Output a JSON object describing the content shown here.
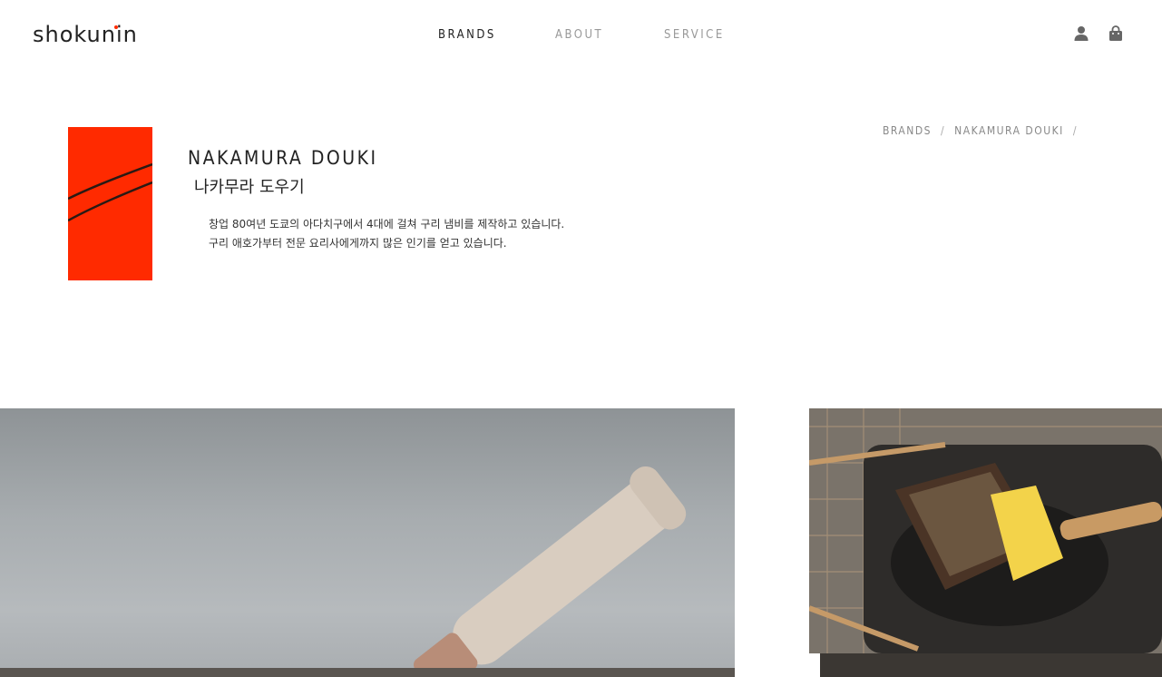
{
  "header": {
    "logo": "shokunin",
    "nav": [
      {
        "label": "BRANDS",
        "active": true
      },
      {
        "label": "ABOUT",
        "active": false
      },
      {
        "label": "SERVICE",
        "active": false
      }
    ],
    "icons": [
      "user-icon",
      "shopping-bag-icon"
    ]
  },
  "breadcrumb": {
    "items": [
      "BRANDS",
      "NAKAMURA DOUKI"
    ],
    "separator": "/"
  },
  "brand": {
    "name_en": "NAKAMURA DOUKI",
    "name_kr": "나카무라 도우기",
    "description": [
      "창업 80여년 도쿄의 아다치구에서 4대에 걸쳐 구리 냄비를 제작하고 있습니다.",
      "구리 애호가부터 전문 요리사에게까지 많은 인기를 얻고 있습니다."
    ],
    "logo_color": "#ff2a00"
  },
  "colors": {
    "accent": "#ff2a00",
    "text": "#222222",
    "muted": "#999999"
  }
}
